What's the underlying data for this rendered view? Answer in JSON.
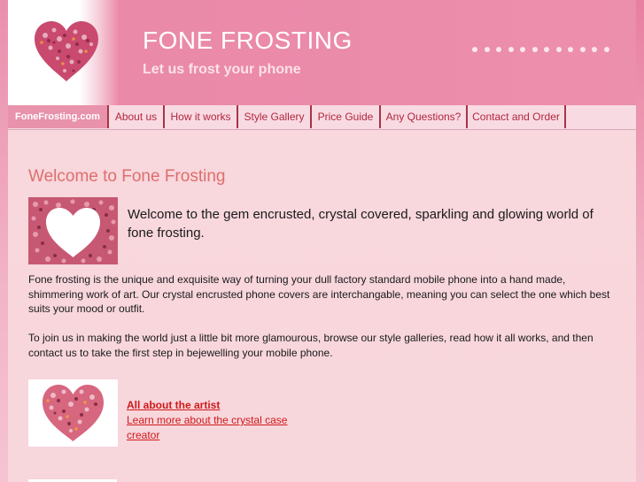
{
  "header": {
    "title": "FONE FROSTING",
    "tagline": "Let us frost your phone",
    "logo_icon": "heart-gems-icon"
  },
  "nav": {
    "items": [
      {
        "label": "FoneFrosting.com",
        "active": true
      },
      {
        "label": "About us"
      },
      {
        "label": "How it works"
      },
      {
        "label": "Style Gallery"
      },
      {
        "label": "Price Guide"
      },
      {
        "label": "Any Questions?"
      },
      {
        "label": "Contact and Order"
      }
    ]
  },
  "main": {
    "heading": "Welcome to Fone Frosting",
    "intro": "Welcome to the gem encrusted, crystal covered, sparkling and glowing world of fone frosting.",
    "para1": "Fone frosting is the unique and exquisite way of turning your dull factory standard mobile phone into a hand made, shimmering work of art. Our crystal encrusted phone covers are interchangable, meaning you can select the one which best suits your mood or outfit.",
    "para2": "To join us in making the world just a little bit more glamourous, browse our style galleries, read how it all works, and then contact us to take the first step in bejewelling your mobile phone.",
    "artist_link": "All about the artist",
    "learn_link": "Learn more about the crystal case creator"
  },
  "colors": {
    "header_pink": "#e98aa8",
    "nav_bg": "#f8dbe2",
    "content_bg": "#f8d7dd",
    "link_red": "#d01919",
    "heading_salmon": "#dd6f6c"
  }
}
